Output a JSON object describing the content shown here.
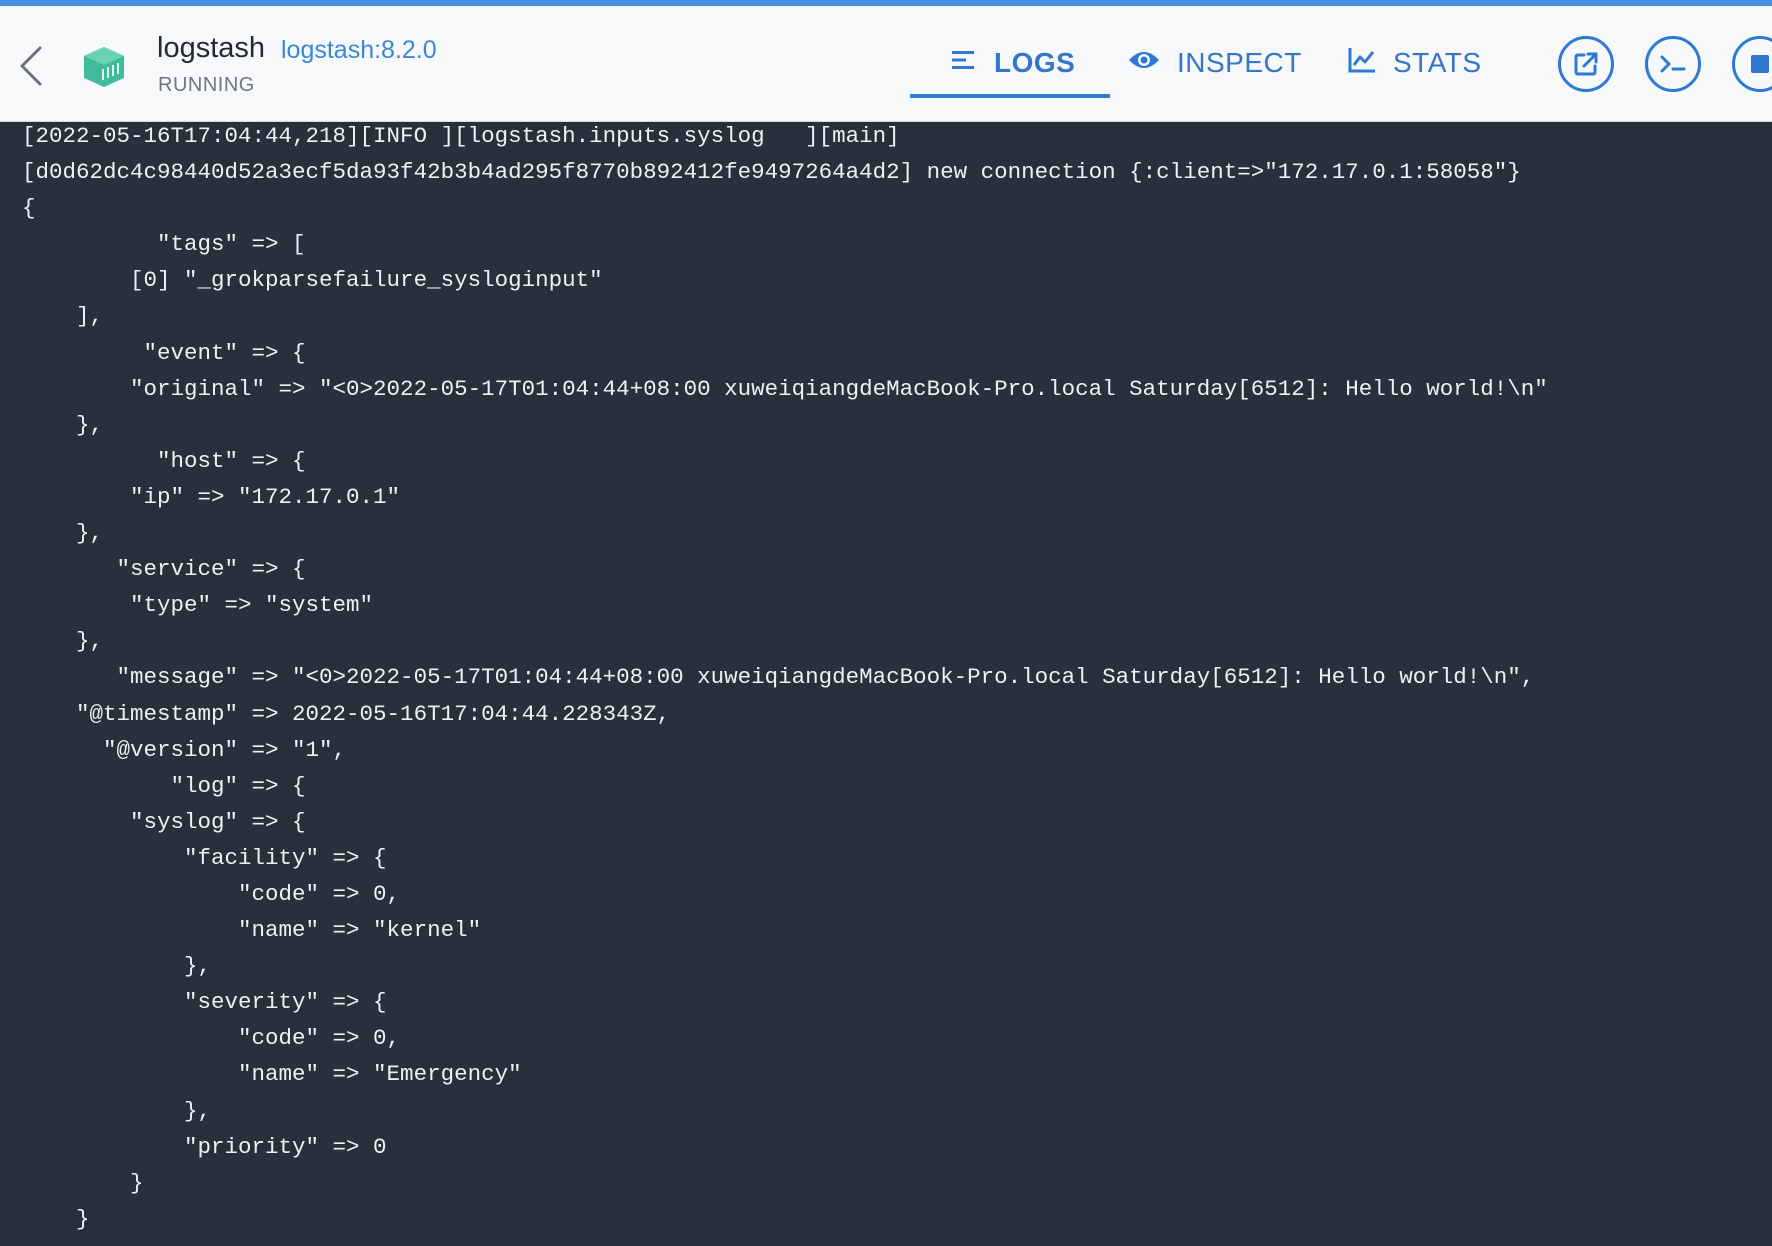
{
  "header": {
    "container_name": "logstash",
    "image_tag": "logstash:8.2.0",
    "status": "RUNNING",
    "back_icon": "chevron-left-icon",
    "container_icon": "container-cube-icon"
  },
  "tabs": [
    {
      "label": "LOGS",
      "icon": "list-lines-icon",
      "active": true
    },
    {
      "label": "INSPECT",
      "icon": "eye-icon",
      "active": false
    },
    {
      "label": "STATS",
      "icon": "line-chart-icon",
      "active": false
    }
  ],
  "actions": [
    {
      "name": "open-in-browser",
      "icon": "external-link-icon"
    },
    {
      "name": "cli",
      "icon": "terminal-icon"
    },
    {
      "name": "stop",
      "icon": "stop-icon"
    }
  ],
  "colors": {
    "accent": "#2f79d3",
    "header_bg": "#f6f8fa",
    "log_bg": "#27313b",
    "log_text": "#eef1f4"
  },
  "log_text": "[2022-05-16T17:04:44,218][INFO ][logstash.inputs.syslog   ][main]\n[d0d62dc4c98440d52a3ecf5da93f42b3b4ad295f8770b892412fe9497264a4d2] new connection {:client=>\"172.17.0.1:58058\"}\n{\n          \"tags\" => [\n        [0] \"_grokparsefailure_sysloginput\"\n    ],\n         \"event\" => {\n        \"original\" => \"<0>2022-05-17T01:04:44+08:00 xuweiqiangdeMacBook-Pro.local Saturday[6512]: Hello world!\\n\"\n    },\n          \"host\" => {\n        \"ip\" => \"172.17.0.1\"\n    },\n       \"service\" => {\n        \"type\" => \"system\"\n    },\n       \"message\" => \"<0>2022-05-17T01:04:44+08:00 xuweiqiangdeMacBook-Pro.local Saturday[6512]: Hello world!\\n\",\n    \"@timestamp\" => 2022-05-16T17:04:44.228343Z,\n      \"@version\" => \"1\",\n           \"log\" => {\n        \"syslog\" => {\n            \"facility\" => {\n                \"code\" => 0,\n                \"name\" => \"kernel\"\n            },\n            \"severity\" => {\n                \"code\" => 0,\n                \"name\" => \"Emergency\"\n            },\n            \"priority\" => 0\n        }\n    }"
}
